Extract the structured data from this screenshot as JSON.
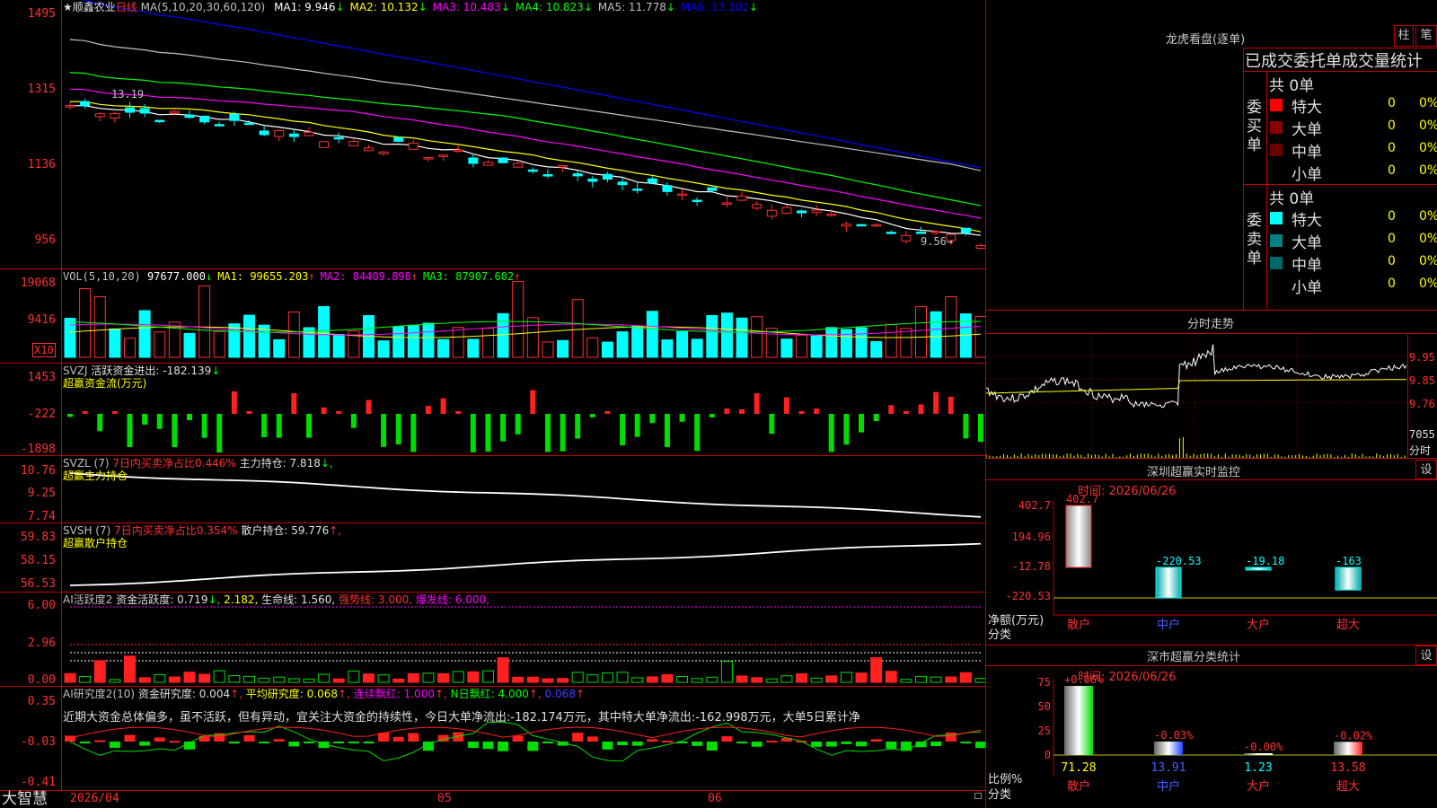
{
  "main": {
    "title": "★顺鑫农业",
    "period": "日线",
    "ma_label": "MA(5,10,20,30,60,120)",
    "ma": [
      {
        "label": "MA1:",
        "value": "9.946",
        "arrow": "↓",
        "color": "#ffffff"
      },
      {
        "label": "MA2:",
        "value": "10.132",
        "arrow": "↓",
        "color": "#ffff00"
      },
      {
        "label": "MA3:",
        "value": "10.483",
        "arrow": "↓",
        "color": "#ff00ff"
      },
      {
        "label": "MA4:",
        "value": "10.823",
        "arrow": "↓",
        "color": "#00ff00"
      },
      {
        "label": "MA5:",
        "value": "11.778",
        "arrow": "↓",
        "color": "#c0c0c0"
      },
      {
        "label": "MA6:",
        "value": "13.102",
        "arrow": "↓",
        "color": "#0000ff"
      }
    ],
    "y_ticks": [
      "1495",
      "1315",
      "1136",
      "956"
    ],
    "hi_label": "13.19",
    "lo_label": "9.56→"
  },
  "vol": {
    "label": "VOL(5,10,20)",
    "value": "97677.000",
    "arrow": "↓",
    "ma": [
      {
        "label": "MA1:",
        "value": "99655.203",
        "arrow": "↑",
        "color": "#ffff00"
      },
      {
        "label": "MA2:",
        "value": "84409.898",
        "arrow": "↑",
        "color": "#ff00ff"
      },
      {
        "label": "MA3:",
        "value": "87907.602",
        "arrow": "↑",
        "color": "#00ff00"
      }
    ],
    "y_ticks": [
      "19068",
      "9416"
    ],
    "unit": "X10"
  },
  "svzj": {
    "label": "SVZJ",
    "desc": "活跃资金进出:",
    "value": "-182.139",
    "arrow": "↓",
    "sub": "超赢资金流(万元)",
    "y_ticks": [
      "1453",
      "-222",
      "-1898"
    ]
  },
  "svzl": {
    "label": "SVZL (7)",
    "desc": "7日内买卖净占比0.446%",
    "desc2": "主力持仓:",
    "value": "7.818",
    "arrow": "↓,",
    "sub": "超赢主力持仓",
    "y_ticks": [
      "10.76",
      "9.25",
      "7.74"
    ]
  },
  "svsh": {
    "label": "SVSH (7)",
    "desc": "7日内买卖净占比0.354%",
    "desc2": "散户持仓:",
    "value": "59.776",
    "arrow": "↑,",
    "sub": "超赢散户持仓",
    "y_ticks": [
      "59.83",
      "58.15",
      "56.53"
    ]
  },
  "ai1": {
    "label": "AI活跃度2",
    "d1": "资金活跃度:",
    "v1": "0.719",
    "a1": "↓,",
    "v2": "2.182,",
    "d3": "生命线:",
    "v3": "1.560,",
    "d4": "强势线:",
    "v4": "3.000,",
    "d5": "爆发线:",
    "v5": "6.000,",
    "y_ticks": [
      "6.00",
      "2.96",
      "0.00"
    ]
  },
  "ai2": {
    "label": "AI研究度2(10)",
    "d1": "资金研究度:",
    "v1": "0.004",
    "a1": "↑,",
    "d2": "平均研究度:",
    "v2": "0.068",
    "a2": "↑,",
    "d3": "连续飘红:",
    "v3": "1.000",
    "a3": "↑,",
    "d4": "N日飘红:",
    "v4": "4.000",
    "a4": "↑,",
    "v5": "0.068",
    "a5": "↑",
    "comment": "近期大资金总体偏多，虽不活跃，但有异动，宜关注大资金的持续性，今日大单净流出:-182.174万元，其中特大单净流出:-162.998万元，大单5日累计净",
    "y_ticks": [
      "0.35",
      "-0.03",
      "-0.41"
    ]
  },
  "bottom": {
    "brand": "大智慧",
    "date1": "2026/04",
    "m5": "05",
    "m6": "06"
  },
  "lhb": {
    "title": "龙虎看盘(逐单)",
    "btn1": "柱",
    "btn2": "笔",
    "header": "已成交委托单成交量统计",
    "buy_label": "委买单",
    "sell_label": "委卖单",
    "buy_total": "共 0单",
    "sell_total": "共 0单",
    "buy_rows": [
      {
        "name": "特大",
        "count": "0",
        "pct": "0%",
        "color": "#ff0000"
      },
      {
        "name": "大单",
        "count": "0",
        "pct": "0%",
        "color": "#8b0000"
      },
      {
        "name": "中单",
        "count": "0",
        "pct": "0%",
        "color": "#6b0000"
      },
      {
        "name": "小单",
        "count": "0",
        "pct": "0%",
        "color": "#000000"
      }
    ],
    "sell_rows": [
      {
        "name": "特大",
        "count": "0",
        "pct": "0%",
        "color": "#00ffff"
      },
      {
        "name": "大单",
        "count": "0",
        "pct": "0%",
        "color": "#008080"
      },
      {
        "name": "中单",
        "count": "0",
        "pct": "0%",
        "color": "#006868"
      },
      {
        "name": "小单",
        "count": "0",
        "pct": "0%",
        "color": "#000000"
      }
    ]
  },
  "fenshi": {
    "title": "分时走势",
    "p1": "9.95",
    "p2": "9.85",
    "p3": "9.76",
    "vol": "7055",
    "unit": "分时"
  },
  "monitor": {
    "title": "深圳超赢实时监控",
    "btn": "设",
    "time": "时间: 2026/06/26",
    "y_ticks": [
      "402.7",
      "194.96",
      "-12.78",
      "-220.53"
    ],
    "ylabel": "净额(万元)",
    "xlabel": "分类",
    "bars": [
      {
        "name": "散户",
        "value": "402.7"
      },
      {
        "name": "中户",
        "value": "-220.53"
      },
      {
        "name": "大户",
        "value": "-19.18"
      },
      {
        "name": "超大",
        "value": "-163"
      }
    ]
  },
  "classify": {
    "title": "深市超赢分类统计",
    "btn": "设",
    "time": "时间: 2026/06/26",
    "y_ticks": [
      "75",
      "50",
      "25",
      "0"
    ],
    "ylabel": "比例%",
    "xlabel": "分类",
    "bars": [
      {
        "name": "散户",
        "pct": "71.28",
        "delta": "+0.06%"
      },
      {
        "name": "中户",
        "pct": "13.91",
        "delta": "-0.03%"
      },
      {
        "name": "大户",
        "pct": "1.23",
        "delta": "-0.00%"
      },
      {
        "name": "超大",
        "pct": "13.58",
        "delta": "-0.02%"
      }
    ]
  }
}
